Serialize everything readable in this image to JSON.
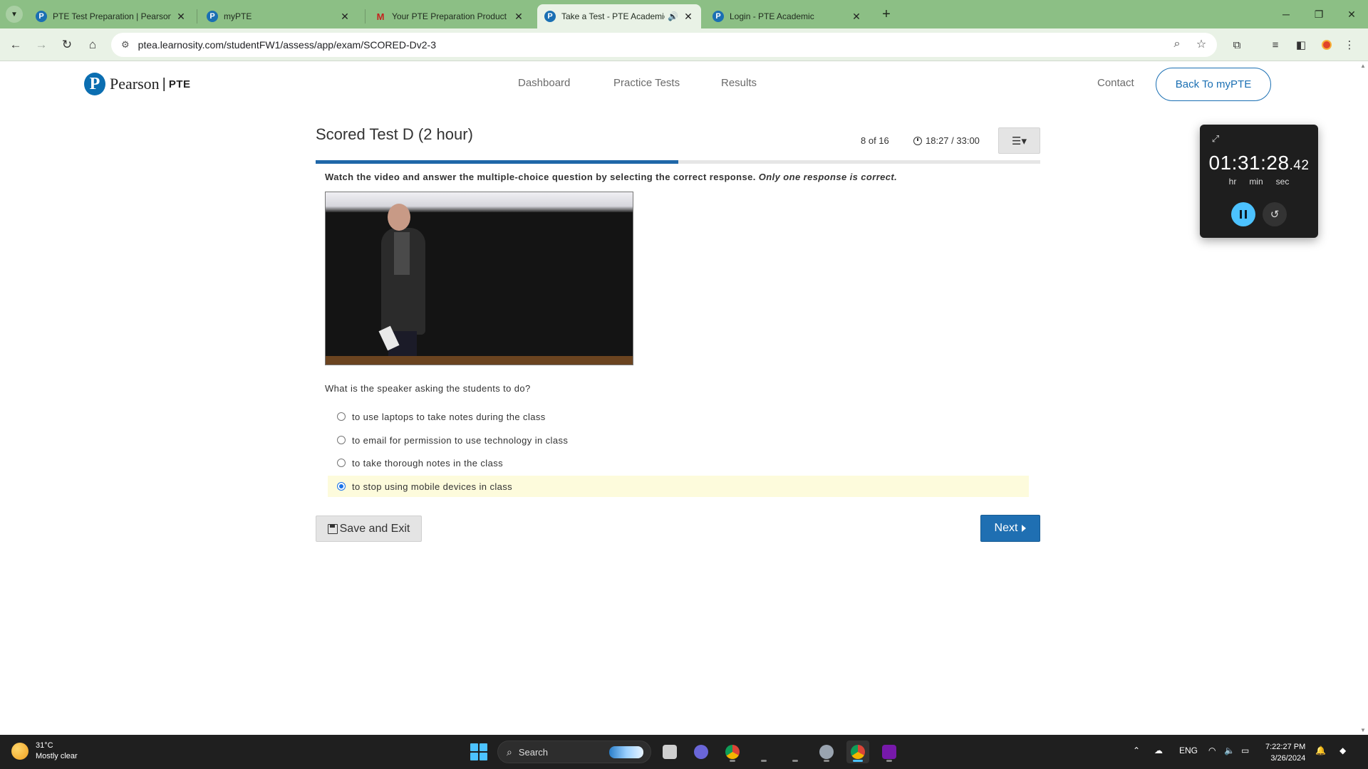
{
  "browser": {
    "tabs": [
      {
        "title": "PTE Test Preparation | Pearson P",
        "favicon": "P",
        "active": false
      },
      {
        "title": "myPTE",
        "favicon": "P",
        "active": false
      },
      {
        "title": "Your PTE Preparation Product V",
        "favicon": "M",
        "active": false
      },
      {
        "title": "Take a Test - PTE Academic",
        "favicon": "P",
        "active": true
      },
      {
        "title": "Login - PTE Academic",
        "favicon": "P",
        "active": false
      }
    ],
    "url": "ptea.learnosity.com/studentFW1/assess/app/exam/SCORED-Dv2-3"
  },
  "header": {
    "logo_text": "Pearson",
    "logo_sub": "PTE",
    "nav": [
      "Dashboard",
      "Practice Tests",
      "Results"
    ],
    "contact": "Contact",
    "back_button": "Back To myPTE"
  },
  "test": {
    "title": "Scored Test D (2 hour)",
    "position": "8 of 16",
    "current_question": 8,
    "total_questions": 16,
    "timer": "18:27 / 33:00",
    "instruction_bold": "Watch the video and answer the multiple-choice question by selecting the correct response.",
    "instruction_italic": "Only one response is correct.",
    "question": "What is the speaker asking the students to do?",
    "options": [
      {
        "label": "to use laptops to take notes during the class",
        "selected": false
      },
      {
        "label": "to email for permission to use technology in class",
        "selected": false
      },
      {
        "label": "to take thorough notes in the class",
        "selected": false
      },
      {
        "label": "to stop using mobile devices in class",
        "selected": true
      }
    ],
    "save_exit_label": "Save and Exit",
    "next_label": "Next"
  },
  "stopwatch": {
    "main": "01:31:28",
    "fraction": ".42",
    "labels": [
      "hr",
      "min",
      "sec"
    ]
  },
  "taskbar": {
    "temperature": "31°C",
    "weather": "Mostly clear",
    "search_placeholder": "Search",
    "language": "ENG",
    "time": "7:22:27 PM",
    "date": "3/26/2024"
  },
  "colors": {
    "brand_blue": "#1f6fb2",
    "tab_strip": "#8cbf85",
    "selected_row": "#fdfbdc",
    "progress": "#1f67a8"
  }
}
